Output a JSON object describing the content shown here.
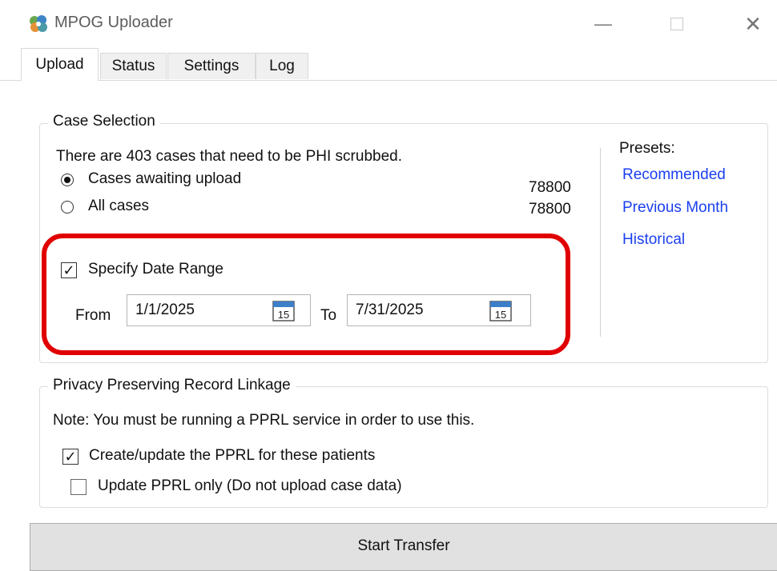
{
  "window": {
    "title": "MPOG Uploader",
    "icon": "mpog-logo-icon",
    "controls": [
      "minimize-icon",
      "maximize-icon",
      "close-icon"
    ]
  },
  "tabs": [
    {
      "label": "Upload",
      "active": true
    },
    {
      "label": "Status",
      "active": false
    },
    {
      "label": "Settings",
      "active": false
    },
    {
      "label": "Log",
      "active": false
    }
  ],
  "case_selection": {
    "legend": "Case Selection",
    "phi_note": "There are 403 cases that need to be PHI scrubbed.",
    "options": [
      {
        "label": "Cases awaiting upload",
        "count": "78800",
        "selected": true
      },
      {
        "label": "All cases",
        "count": "78800",
        "selected": false
      }
    ],
    "date_range": {
      "label": "Specify Date Range",
      "checked": true,
      "from_label": "From",
      "from_value": "1/1/2025",
      "to_label": "To",
      "to_value": "7/31/2025",
      "calendar_icon_text": "15"
    },
    "presets": {
      "label": "Presets:",
      "items": [
        "Recommended",
        "Previous Month",
        "Historical"
      ]
    }
  },
  "pprl": {
    "legend": "Privacy Preserving Record Linkage",
    "note": "Note: You must be running a PPRL service in order to use this.",
    "create_update": {
      "label": "Create/update the PPRL for these patients",
      "checked": true
    },
    "update_only": {
      "label": "Update PPRL only (Do not upload case data)",
      "checked": false
    }
  },
  "start_button": {
    "label": "Start Transfer"
  },
  "colors": {
    "highlight": "#e00000",
    "link": "#1a3ff0",
    "button_bg": "#e1e1e1"
  }
}
